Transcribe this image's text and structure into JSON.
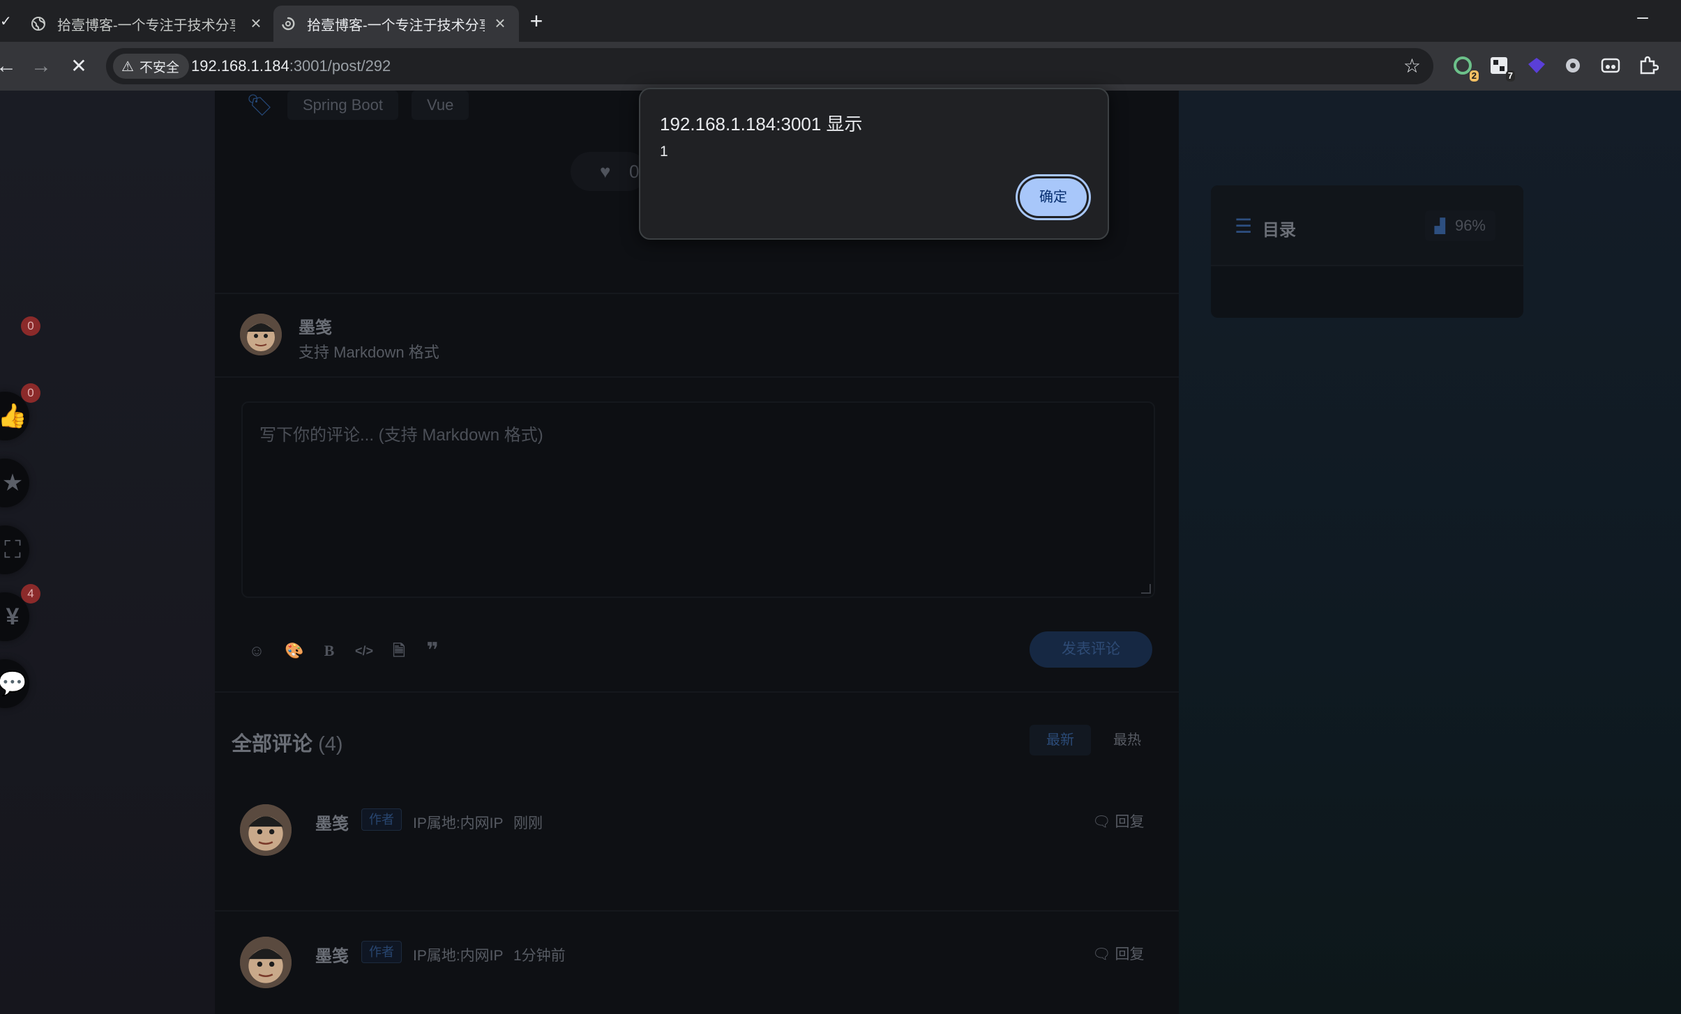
{
  "browser": {
    "tabs": [
      {
        "title": "拾壹博客-一个专注于技术分享的"
      },
      {
        "title": "拾壹博客-一个专注于技术分享的"
      }
    ],
    "new_tab": "+",
    "security_label": "不安全",
    "url_host": "192.168.1.184",
    "url_rest": ":3001/post/292",
    "extensions": [
      {
        "name": "extension-a",
        "badge": "2"
      },
      {
        "name": "extension-b",
        "badge": "7"
      }
    ]
  },
  "article": {
    "tags": [
      "Spring Boot",
      "Vue"
    ],
    "like_count": "0"
  },
  "sidebar_actions": [
    {
      "name": "like",
      "icon": "thumbs-up-icon",
      "badge": "0"
    },
    {
      "name": "favorite",
      "icon": "star-icon",
      "badge": "0"
    },
    {
      "name": "fullscreen",
      "icon": "fullscreen-icon",
      "badge": ""
    },
    {
      "name": "reward",
      "icon": "yen-icon",
      "badge": ""
    },
    {
      "name": "comments",
      "icon": "comment-icon",
      "badge": "4"
    }
  ],
  "comment_form": {
    "user_name": "墨笺",
    "hint": "支持 Markdown 格式",
    "placeholder": "写下你的评论... (支持 Markdown 格式)",
    "toolbar_icons": [
      "emoji-icon",
      "palette-icon",
      "bold-icon",
      "code-icon",
      "file-icon",
      "quote-icon"
    ],
    "bold_glyph": "B",
    "submit_label": "发表评论"
  },
  "comments": {
    "title": "全部评论",
    "count": "(4)",
    "sort_new": "最新",
    "sort_hot": "最热",
    "items": [
      {
        "author": "墨笺",
        "badge": "作者",
        "ip": "IP属地:内网IP",
        "time": "刚刚",
        "reply": "回复"
      },
      {
        "author": "墨笺",
        "badge": "作者",
        "ip": "IP属地:内网IP",
        "time": "1分钟前",
        "reply": "回复"
      }
    ]
  },
  "toc": {
    "title": "目录",
    "progress": "96%"
  },
  "dialog": {
    "title": "192.168.1.184:3001 显示",
    "message": "1",
    "ok_label": "确定"
  },
  "colors": {
    "accent": "#a8c7fa",
    "dim_blue": "#2b4b78",
    "badge_red": "#8b2a2a"
  }
}
